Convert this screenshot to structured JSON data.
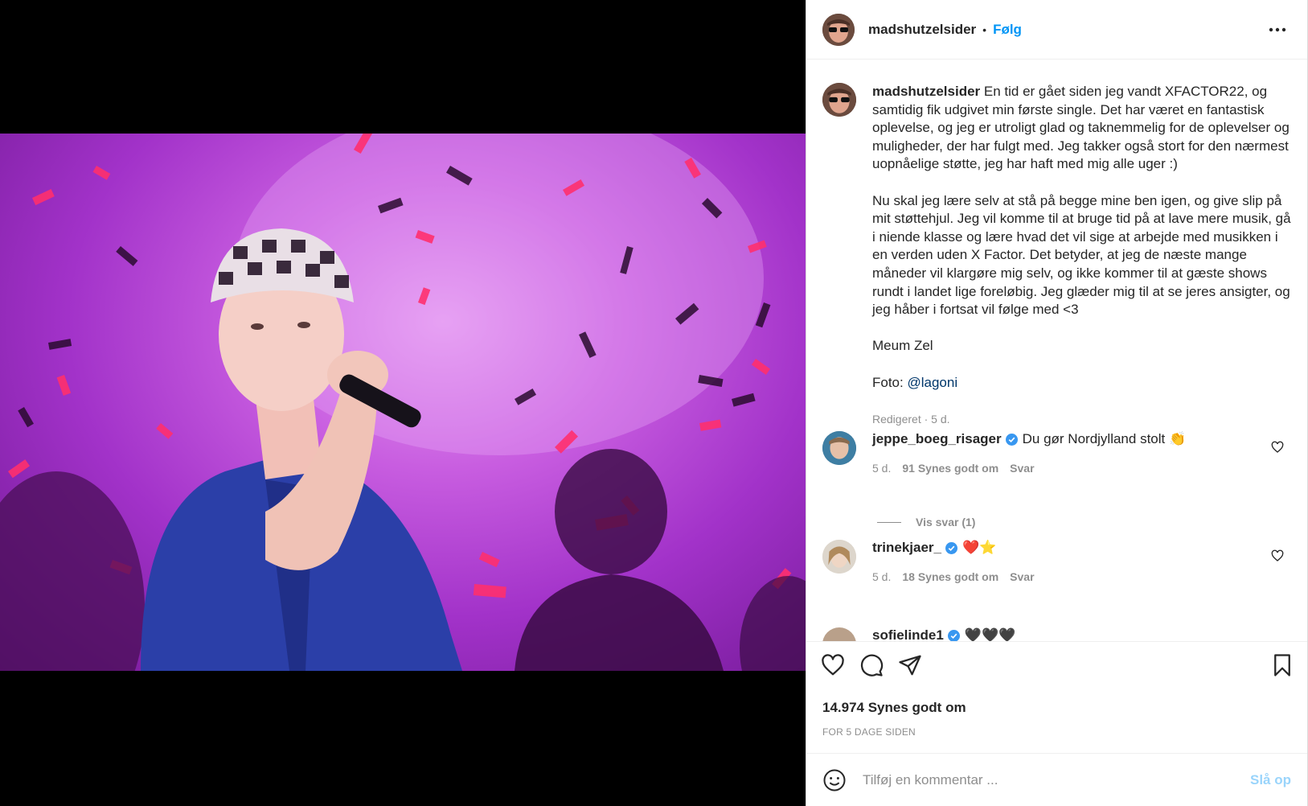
{
  "post": {
    "username": "madshutzelsider",
    "separator": "•",
    "follow_label": "Følg",
    "caption_paragraphs": [
      "En tid er gået siden jeg vandt XFACTOR22, og samtidig fik udgivet min første single. Det har været en fantastisk oplevelse, og jeg er utroligt glad og taknemmelig for de oplevelser og muligheder, der har fulgt med. Jeg takker også stort for den nærmest uopnåelige støtte, jeg har haft med mig alle uger :)",
      "Nu skal jeg lære selv at stå på begge mine ben igen, og give slip på mit støttehjul. Jeg vil komme til at bruge tid på at lave mere musik, gå i niende klasse og lære hvad det vil sige at arbejde med musikken i en verden uden X Factor. Det betyder, at jeg de næste mange måneder vil klargøre mig selv, og ikke kommer til at gæste shows rundt i landet lige foreløbig. Jeg glæder mig til at se jeres ansigter, og jeg håber i fortsat vil følge med <3",
      "Meum Zel"
    ],
    "photo_credit_prefix": "Foto: ",
    "photo_credit_mention": "@lagoni",
    "caption_meta": "Redigeret · 5 d.",
    "likes": "14.974 Synes godt om",
    "posted_ago": "FOR 5 DAGE SIDEN"
  },
  "comments": [
    {
      "username": "jeppe_boeg_risager",
      "verified": true,
      "text": "Du gør Nordjylland stolt 👏",
      "age": "5 d.",
      "likes": "91 Synes godt om",
      "reply_label": "Svar",
      "view_replies": "Vis svar (1)"
    },
    {
      "username": "trinekjaer_",
      "verified": true,
      "text": "❤️⭐",
      "age": "5 d.",
      "likes": "18 Synes godt om",
      "reply_label": "Svar"
    },
    {
      "username": "sofielinde1",
      "verified": true,
      "text": "🖤🖤🖤"
    }
  ],
  "composer": {
    "placeholder": "Tilføj en kommentar ...",
    "post_label": "Slå op"
  },
  "colors": {
    "accent": "#0095f6",
    "text": "#262626",
    "muted": "#8e8e8e",
    "photo_bg": "#b54bd8",
    "confetti": "#f0307a"
  },
  "icons": [
    "more-options-icon",
    "like-icon",
    "comment-icon",
    "share-icon",
    "bookmark-icon",
    "emoji-icon",
    "verified-icon",
    "small-heart-icon"
  ]
}
